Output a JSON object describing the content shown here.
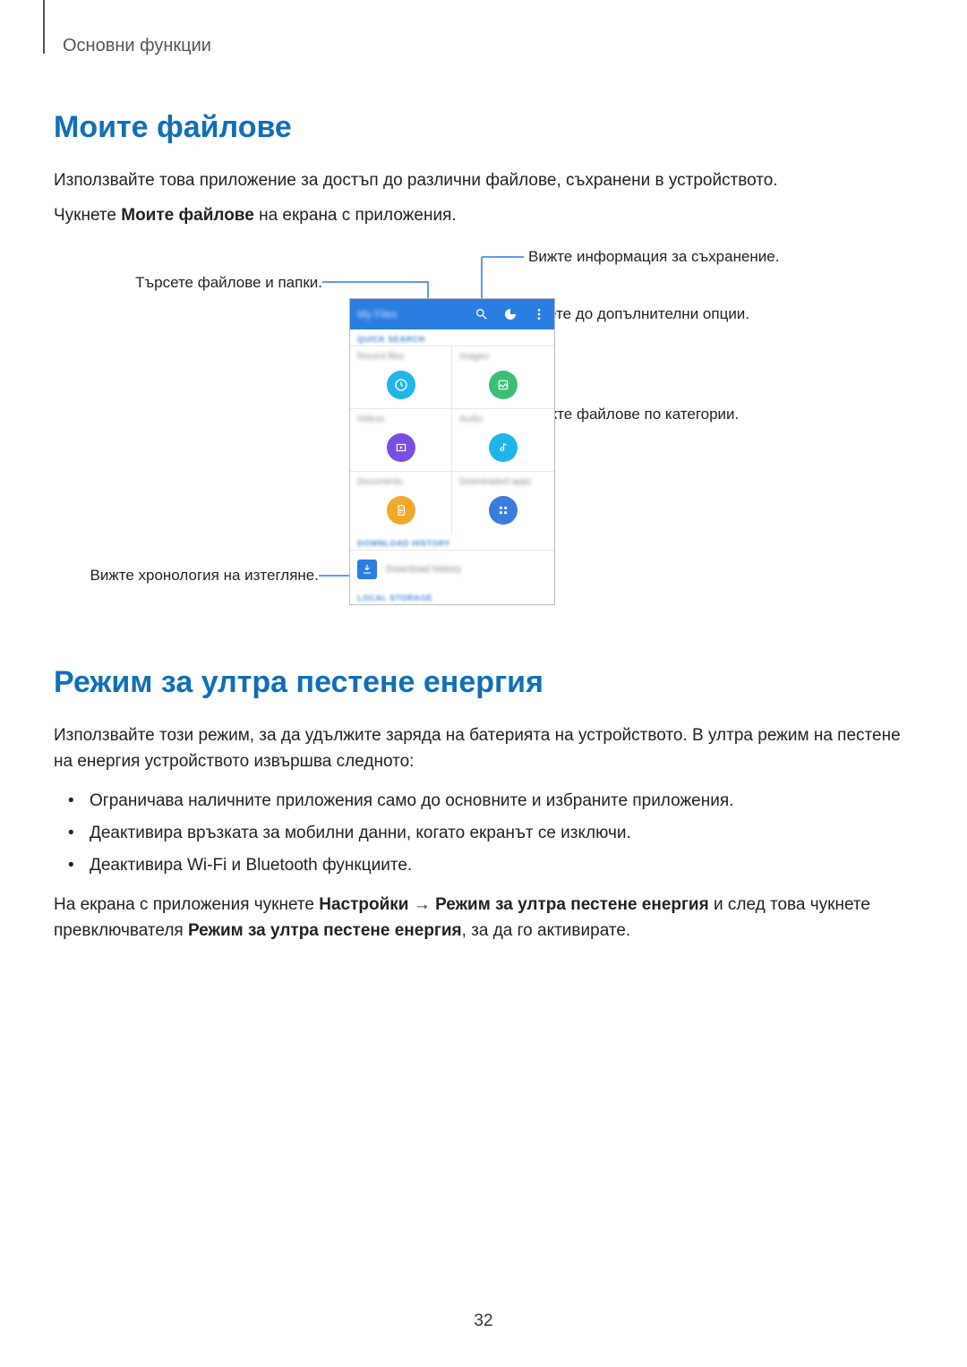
{
  "header": {
    "breadcrumb": "Основни функции"
  },
  "section1": {
    "title": "Моите файлове",
    "p1": "Използвайте това приложение за достъп до различни файлове, съхранени в устройството.",
    "p2_pre": "Чукнете ",
    "p2_bold": "Моите файлове",
    "p2_post": " на екрана с приложения."
  },
  "callouts": {
    "c1": "Търсете файлове и папки.",
    "c2": "Вижте информация за съхранение.",
    "c3": "Идете до допълнителни опции.",
    "c4": "Вижте файлове по категории.",
    "c5": "Вижте хронология на изтегляне."
  },
  "phone": {
    "title": "My Files",
    "quick_search": "QUICK SEARCH",
    "categories": [
      {
        "label": "Recent files",
        "color": "#1fb5e8"
      },
      {
        "label": "Images",
        "color": "#3bbf77"
      },
      {
        "label": "Videos",
        "color": "#7a4fe0"
      },
      {
        "label": "Audio",
        "color": "#1fb5e8"
      },
      {
        "label": "Documents",
        "color": "#f0a92a"
      },
      {
        "label": "Downloaded apps",
        "color": "#3a7ce0"
      }
    ],
    "download_hist_label": "DOWNLOAD HISTORY",
    "download_hist_row": "Download history",
    "local_storage": "LOCAL STORAGE"
  },
  "section2": {
    "title": "Режим за ултра пестене енергия",
    "p1": "Използвайте този режим, за да удължите заряда на батерията на устройството. В ултра режим на пестене на енергия устройството извършва следното:",
    "bullets": [
      "Ограничава наличните приложения само до основните и избраните приложения.",
      "Деактивира връзката за мобилни данни, когато екранът се изключи.",
      "Деактивира Wi-Fi и Bluetooth функциите."
    ],
    "p2_parts": [
      {
        "t": "На екрана с приложения чукнете ",
        "b": false
      },
      {
        "t": "Настройки",
        "b": true
      },
      {
        "t": " → ",
        "b": false
      },
      {
        "t": "Режим за ултра пестене енергия",
        "b": true
      },
      {
        "t": " и след това чукнете превключвателя ",
        "b": false
      },
      {
        "t": "Режим за ултра пестене енергия",
        "b": true
      },
      {
        "t": ", за да го активирате.",
        "b": false
      }
    ]
  },
  "page_number": "32"
}
